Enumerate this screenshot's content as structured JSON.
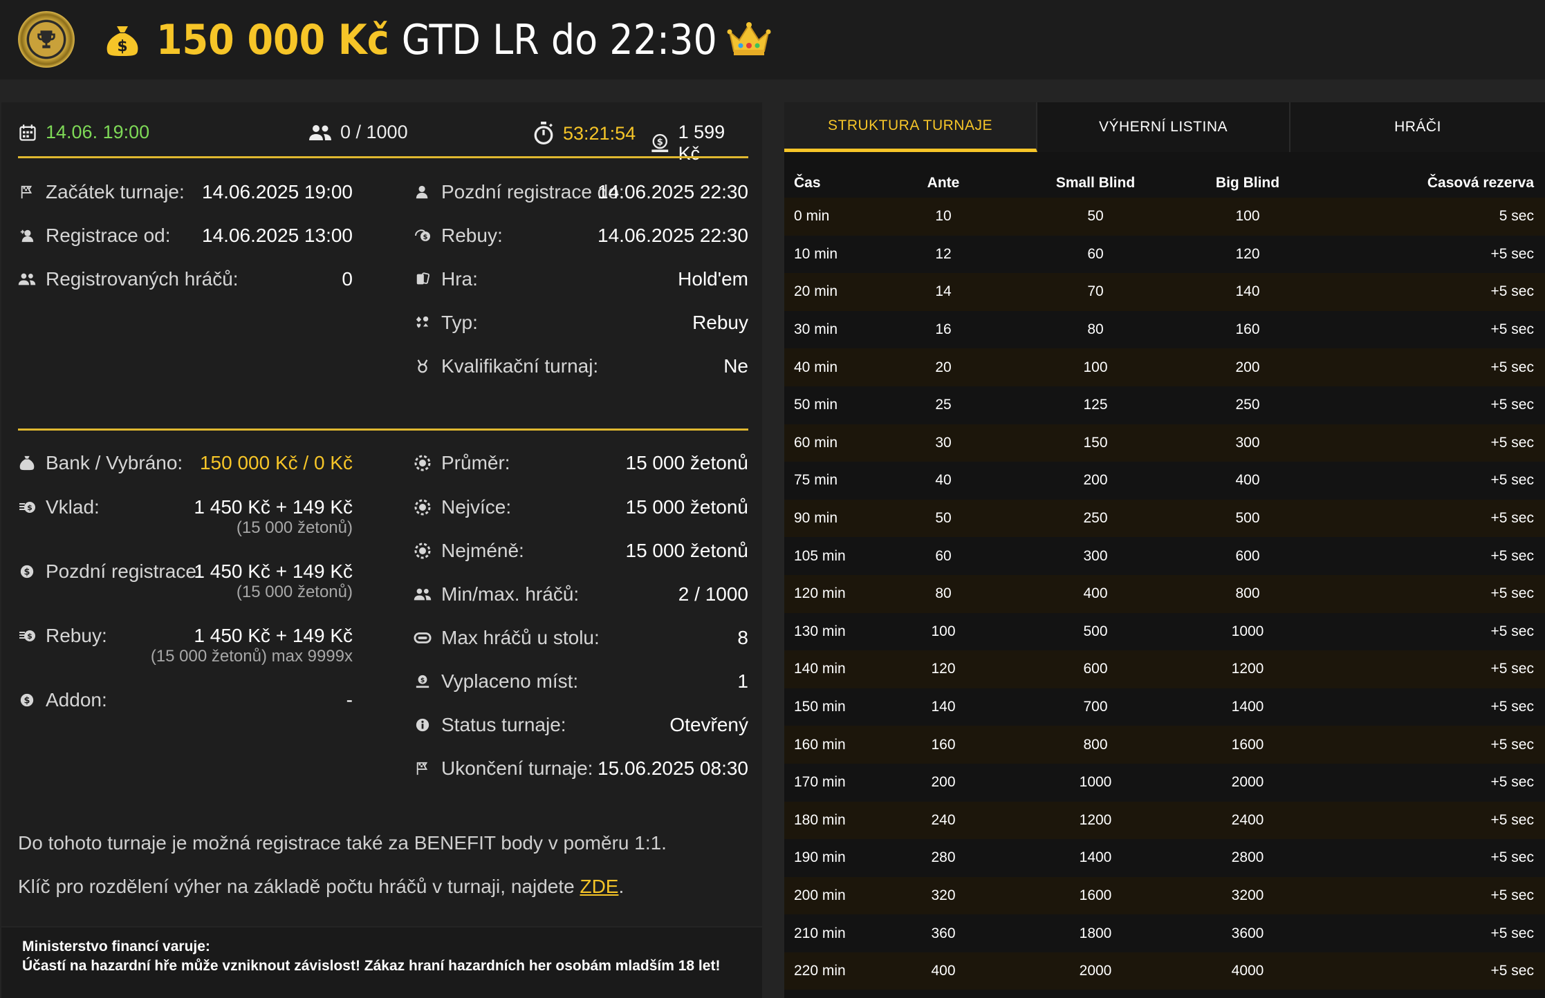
{
  "header": {
    "title_amount": "150 000 Kč",
    "title_rest": "GTD LR do 22:30"
  },
  "summary": {
    "date": "14.06. 19:00",
    "players": "0 / 1000",
    "timer": "53:21:54",
    "fee": "1 599 Kč"
  },
  "info_left": [
    {
      "label": "Začátek turnaje:",
      "value": "14.06.2025 19:00"
    },
    {
      "label": "Registrace od:",
      "value": "14.06.2025 13:00"
    },
    {
      "label": "Registrovaných hráčů:",
      "value": "0"
    }
  ],
  "info_right": [
    {
      "label": "Pozdní registrace do:",
      "value": "14.06.2025 22:30"
    },
    {
      "label": "Rebuy:",
      "value": "14.06.2025 22:30"
    },
    {
      "label": "Hra:",
      "value": "Hold'em"
    },
    {
      "label": "Typ:",
      "value": "Rebuy"
    },
    {
      "label": "Kvalifikační turnaj:",
      "value": "Ne"
    }
  ],
  "money_left": [
    {
      "label": "Bank / Vybráno:",
      "value": "150 000 Kč / 0 Kč",
      "sub": ""
    },
    {
      "label": "Vklad:",
      "value": "1 450 Kč + 149 Kč",
      "sub": "(15 000 žetonů)"
    },
    {
      "label": "Pozdní registrace:",
      "value": "1 450 Kč + 149 Kč",
      "sub": "(15 000 žetonů)"
    },
    {
      "label": "Rebuy:",
      "value": "1 450 Kč + 149 Kč",
      "sub": "(15 000 žetonů) max 9999x"
    },
    {
      "label": "Addon:",
      "value": "-",
      "sub": ""
    }
  ],
  "money_right": [
    {
      "label": "Průměr:",
      "value": "15 000 žetonů"
    },
    {
      "label": "Nejvíce:",
      "value": "15 000 žetonů"
    },
    {
      "label": "Nejméně:",
      "value": "15 000 žetonů"
    },
    {
      "label": "Min/max. hráčů:",
      "value": "2 / 1000"
    },
    {
      "label": "Max hráčů u stolu:",
      "value": "8"
    },
    {
      "label": "Vyplaceno míst:",
      "value": "1"
    },
    {
      "label": "Status turnaje:",
      "value": "Otevřený"
    },
    {
      "label": "Ukončení turnaje:",
      "value": "15.06.2025 08:30"
    }
  ],
  "notes": {
    "benefit": "Do tohoto turnaje je možná registrace také za BENEFIT body v poměru 1:1.",
    "key_prefix": "Klíč pro rozdělení výher na základě počtu hráčů v turnaji, najdete ",
    "key_link": "ZDE",
    "key_suffix": "."
  },
  "warning": {
    "line1": "Ministerstvo financí varuje:",
    "line2": "Účastí na hazardní hře může vzniknout závislost! Zákaz hraní hazardních her osobám mladším 18 let!"
  },
  "tabs": [
    "STRUKTURA TURNAJE",
    "VÝHERNÍ LISTINA",
    "HRÁČI"
  ],
  "table": {
    "headers": [
      "Čas",
      "Ante",
      "Small Blind",
      "Big Blind",
      "Časová rezerva"
    ],
    "rows": [
      [
        "0 min",
        "10",
        "50",
        "100",
        "5 sec"
      ],
      [
        "10 min",
        "12",
        "60",
        "120",
        "+5 sec"
      ],
      [
        "20 min",
        "14",
        "70",
        "140",
        "+5 sec"
      ],
      [
        "30 min",
        "16",
        "80",
        "160",
        "+5 sec"
      ],
      [
        "40 min",
        "20",
        "100",
        "200",
        "+5 sec"
      ],
      [
        "50 min",
        "25",
        "125",
        "250",
        "+5 sec"
      ],
      [
        "60 min",
        "30",
        "150",
        "300",
        "+5 sec"
      ],
      [
        "75 min",
        "40",
        "200",
        "400",
        "+5 sec"
      ],
      [
        "90 min",
        "50",
        "250",
        "500",
        "+5 sec"
      ],
      [
        "105 min",
        "60",
        "300",
        "600",
        "+5 sec"
      ],
      [
        "120 min",
        "80",
        "400",
        "800",
        "+5 sec"
      ],
      [
        "130 min",
        "100",
        "500",
        "1000",
        "+5 sec"
      ],
      [
        "140 min",
        "120",
        "600",
        "1200",
        "+5 sec"
      ],
      [
        "150 min",
        "140",
        "700",
        "1400",
        "+5 sec"
      ],
      [
        "160 min",
        "160",
        "800",
        "1600",
        "+5 sec"
      ],
      [
        "170 min",
        "200",
        "1000",
        "2000",
        "+5 sec"
      ],
      [
        "180 min",
        "240",
        "1200",
        "2400",
        "+5 sec"
      ],
      [
        "190 min",
        "280",
        "1400",
        "2800",
        "+5 sec"
      ],
      [
        "200 min",
        "320",
        "1600",
        "3200",
        "+5 sec"
      ],
      [
        "210 min",
        "360",
        "1800",
        "3600",
        "+5 sec"
      ],
      [
        "220 min",
        "400",
        "2000",
        "4000",
        "+5 sec"
      ]
    ]
  },
  "colors": {
    "accent": "#f6c528",
    "green": "#7ed957"
  },
  "icons": [
    "trophy-icon",
    "moneybag-icon",
    "crown-icon",
    "calendar-icon",
    "players-icon",
    "stopwatch-icon",
    "coin-icon"
  ]
}
